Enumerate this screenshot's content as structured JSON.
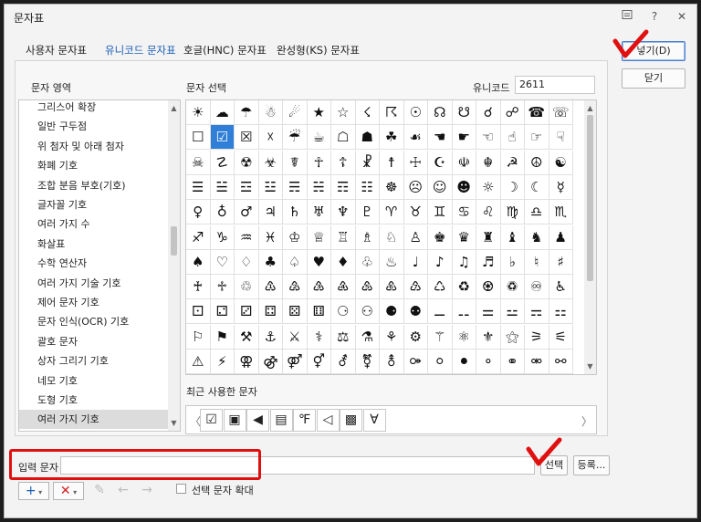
{
  "window": {
    "title": "문자표"
  },
  "tabs": [
    {
      "label": "사용자 문자표"
    },
    {
      "label": "유니코드 문자표"
    },
    {
      "label": "호글(HNC) 문자표"
    },
    {
      "label": "완성형(KS) 문자표"
    }
  ],
  "left": {
    "heading": "문자 영역",
    "items": [
      "그리스어 확장",
      "일반 구두점",
      "위 첨자 및 아래 첨자",
      "화폐 기호",
      "조합 분음 부호(기호)",
      "글자꼴 기호",
      "여러 가지 수",
      "화살표",
      "수학 연산자",
      "여러 가지 기술 기호",
      "제어 문자 기호",
      "문자 인식(OCR) 기호",
      "괄호 문자",
      "상자 그리기 기호",
      "네모 기호",
      "도형 기호",
      "여러 가지 기호"
    ],
    "selected_index": 16
  },
  "center": {
    "heading": "문자 선택",
    "unicode_label": "유니코드",
    "unicode_value": "2611",
    "grid": [
      [
        "☀",
        "☁",
        "☂",
        "☃",
        "☄",
        "★",
        "☆",
        "☇",
        "☈",
        "☉",
        "☊",
        "☋",
        "☌",
        "☍",
        "☎",
        "☏"
      ],
      [
        "☐",
        "☑",
        "☒",
        "☓",
        "☔",
        "☕",
        "☖",
        "☗",
        "☘",
        "☙",
        "☚",
        "☛",
        "☜",
        "☝",
        "☞",
        "☟"
      ],
      [
        "☠",
        "☡",
        "☢",
        "☣",
        "☤",
        "☥",
        "☦",
        "☧",
        "☨",
        "☩",
        "☪",
        "☫",
        "☬",
        "☭",
        "☮",
        "☯"
      ],
      [
        "☰",
        "☱",
        "☲",
        "☳",
        "☴",
        "☵",
        "☶",
        "☷",
        "☸",
        "☹",
        "☺",
        "☻",
        "☼",
        "☽",
        "☾",
        "☿"
      ],
      [
        "♀",
        "♁",
        "♂",
        "♃",
        "♄",
        "♅",
        "♆",
        "♇",
        "♈",
        "♉",
        "♊",
        "♋",
        "♌",
        "♍",
        "♎",
        "♏"
      ],
      [
        "♐",
        "♑",
        "♒",
        "♓",
        "♔",
        "♕",
        "♖",
        "♗",
        "♘",
        "♙",
        "♚",
        "♛",
        "♜",
        "♝",
        "♞",
        "♟"
      ],
      [
        "♠",
        "♡",
        "♢",
        "♣",
        "♤",
        "♥",
        "♦",
        "♧",
        "♨",
        "♩",
        "♪",
        "♫",
        "♬",
        "♭",
        "♮",
        "♯"
      ],
      [
        "♰",
        "♱",
        "♲",
        "♳",
        "♴",
        "♵",
        "♶",
        "♷",
        "♸",
        "♹",
        "♺",
        "♻",
        "♼",
        "♽",
        "♾",
        "♿"
      ],
      [
        "⚀",
        "⚁",
        "⚂",
        "⚃",
        "⚄",
        "⚅",
        "⚆",
        "⚇",
        "⚈",
        "⚉",
        "⚊",
        "⚋",
        "⚌",
        "⚍",
        "⚎",
        "⚏"
      ],
      [
        "⚐",
        "⚑",
        "⚒",
        "⚓",
        "⚔",
        "⚕",
        "⚖",
        "⚗",
        "⚘",
        "⚙",
        "⚚",
        "⚛",
        "⚜",
        "⚝",
        "⚞",
        "⚟"
      ],
      [
        "⚠",
        "⚡",
        "⚢",
        "⚣",
        "⚤",
        "⚥",
        "⚦",
        "⚧",
        "⚨",
        "⚩",
        "⚪",
        "⚫",
        "⚬",
        "⚭",
        "⚮",
        "⚯"
      ]
    ],
    "selected_cell": [
      1,
      1
    ],
    "recent_label": "최근 사용한 문자",
    "recent": [
      "☑",
      "▣",
      "◀",
      "▤",
      "℉",
      "◁",
      "▩",
      "∀"
    ]
  },
  "buttons": {
    "insert": "넣기(D)",
    "close": "닫기",
    "select": "선택",
    "register": "등록..."
  },
  "bottom": {
    "input_label": "입력 문자",
    "input_value": "",
    "enlarge_label": "선택 문자 확대"
  },
  "icons": {
    "help": "?",
    "close": "✕",
    "add": "+",
    "delete": "✕",
    "edit": "✎",
    "back": "←",
    "forward": "→"
  },
  "colors": {
    "accent": "#1a5fb4",
    "selection": "#2f7ed8",
    "annotation": "#e01010"
  }
}
